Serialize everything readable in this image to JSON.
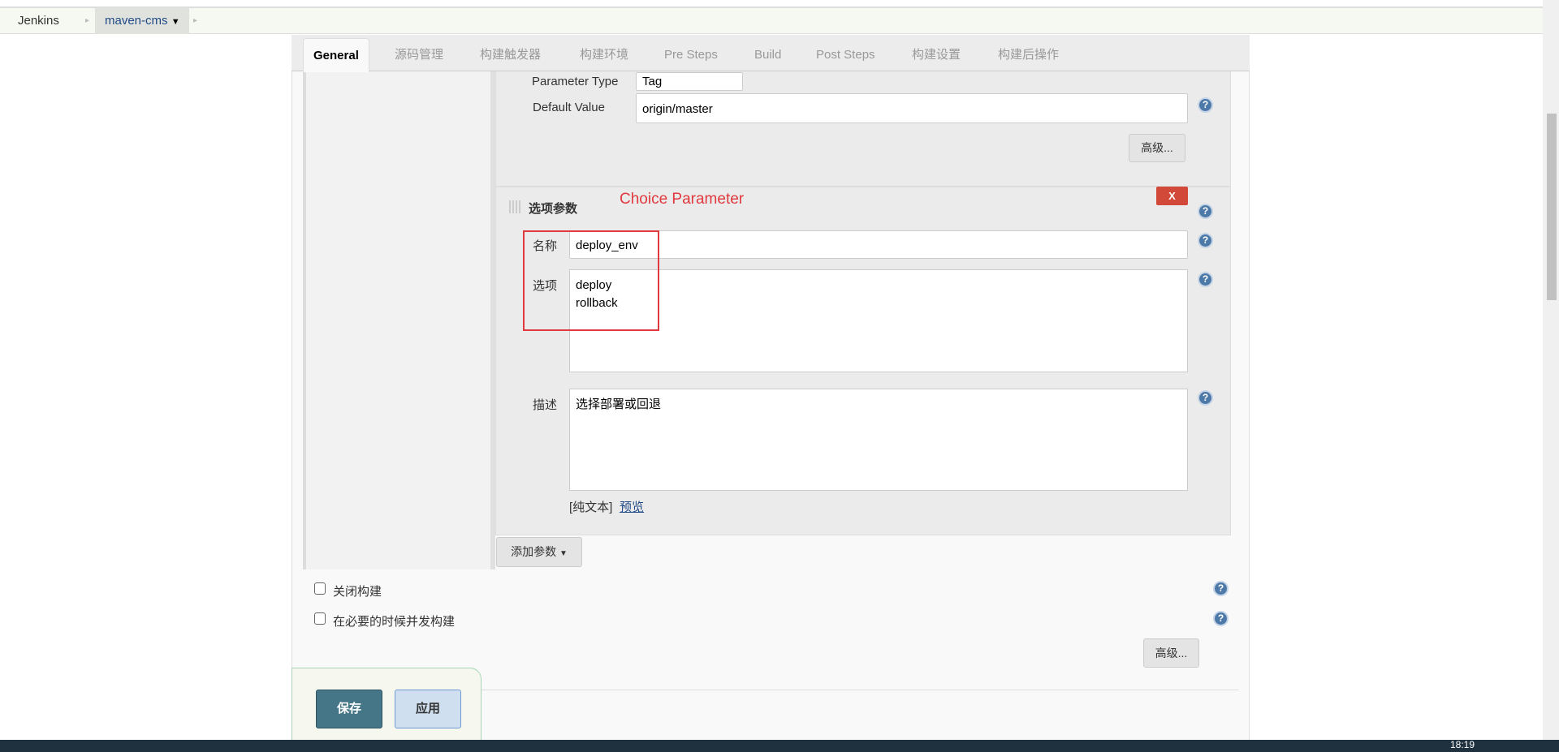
{
  "breadcrumb": {
    "items": [
      "Jenkins",
      "maven-cms"
    ]
  },
  "tabs": [
    "General",
    "源码管理",
    "构建触发器",
    "构建环境",
    "Pre Steps",
    "Build",
    "Post Steps",
    "构建设置",
    "构建后操作"
  ],
  "string_param": {
    "type_label": "Parameter Type",
    "type_value": "Tag",
    "default_label": "Default Value",
    "default_value": "origin/master",
    "advanced_label": "高级..."
  },
  "choice_param": {
    "title": "选项参数",
    "annotation": "Choice Parameter",
    "delete_label": "X",
    "name_label": "名称",
    "name_value": "deploy_env",
    "choices_label": "选项",
    "choices_value": "deploy\nrollback",
    "desc_label": "描述",
    "desc_value": "选择部署或回退",
    "plain_text": "[纯文本]",
    "preview": "预览"
  },
  "add_param_label": "添加参数",
  "options": {
    "disable_build": "关闭构建",
    "concurrent_build": "在必要的时候并发构建",
    "advanced_label": "高级..."
  },
  "footer": {
    "save": "保存",
    "apply": "应用"
  },
  "taskbar": {
    "time": "18:19"
  },
  "colors": {
    "annotation": "#e0393e",
    "save": "#457687",
    "apply": "#cfdff0",
    "delete": "#d24939"
  }
}
